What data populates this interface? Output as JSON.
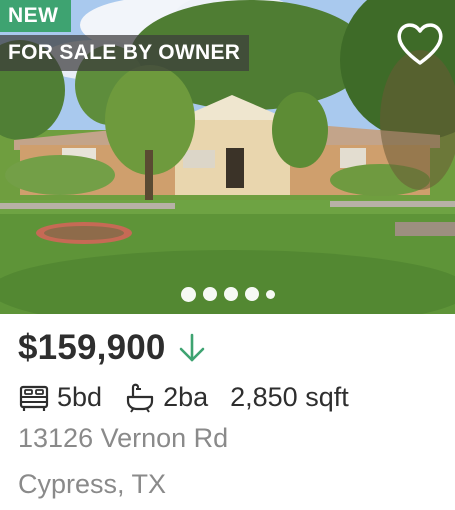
{
  "listing": {
    "badges": {
      "new": "NEW",
      "sale_type": "FOR SALE BY OWNER"
    },
    "favorite_icon": "heart-outline-icon",
    "photo": {
      "description_icon": "house-photo",
      "carousel": {
        "count": 5,
        "active_index": 0
      }
    },
    "price": "$159,900",
    "price_trend_icon": "arrow-down-icon",
    "price_trend_color": "#3ea371",
    "facts": {
      "beds": "5bd",
      "beds_icon": "bed-icon",
      "baths": "2ba",
      "baths_icon": "bathtub-icon",
      "sqft": "2,850 sqft"
    },
    "address": {
      "street": "13126 Vernon Rd",
      "city_state": "Cypress, TX"
    }
  },
  "colors": {
    "badge_new": "#3ea371",
    "badge_sale_type": "#3c3c3c",
    "price_text": "#2e2e2e",
    "address_text": "#8a8a8a"
  }
}
